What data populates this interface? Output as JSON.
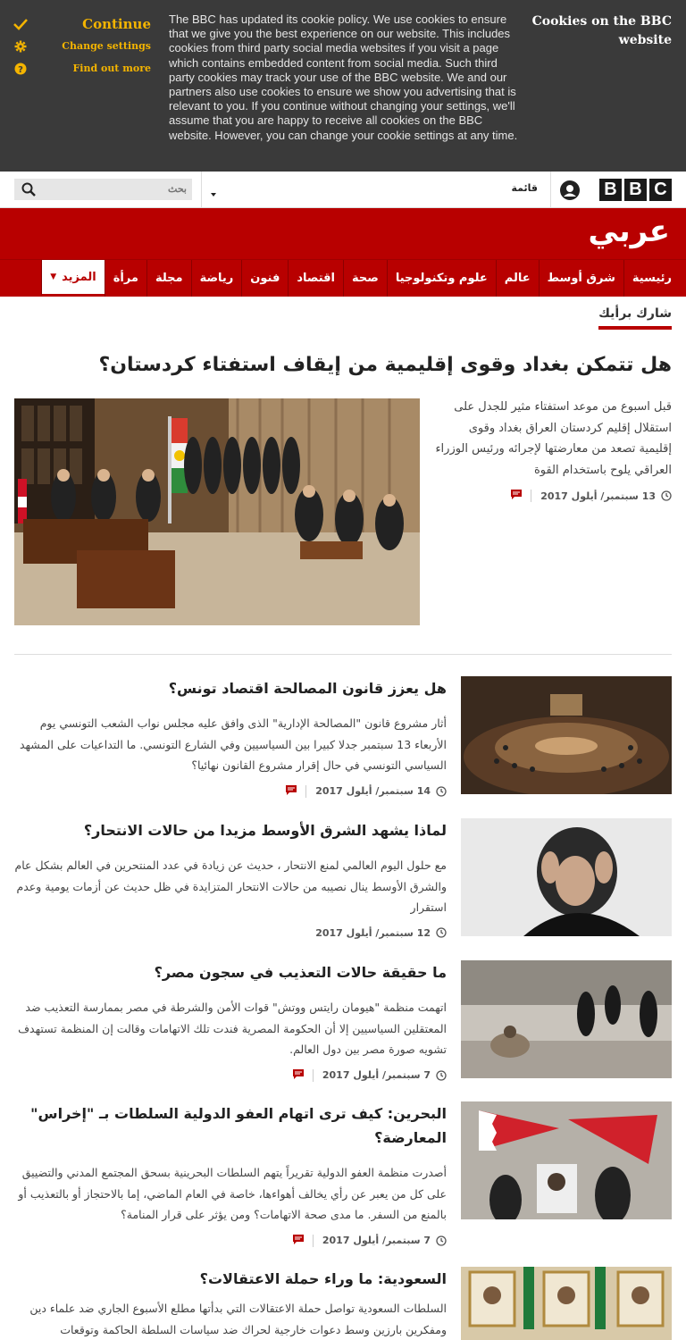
{
  "cookie_banner": {
    "continue_label": "Continue",
    "change_label": "Change settings",
    "find_label": "Find out more",
    "message": "The BBC has updated its cookie policy. We use cookies to ensure that we give you the best experience on our website. This includes cookies from third party social media websites if you visit a page which contains embedded content from social media. Such third party cookies may track your use of the BBC website. We and our partners also use cookies to ensure we show you advertising that is relevant to you. If you continue without changing your settings, we'll assume that you are happy to receive all cookies on the BBC website. However, you can change your cookie settings at any time.",
    "title": "Cookies on the BBC website",
    "accent_color": "#f4b400"
  },
  "masthead": {
    "bbc_letters": [
      "B",
      "B",
      "C"
    ],
    "menu_label": "قائمة",
    "search_placeholder": "بحث"
  },
  "brand": {
    "logo_text": "عربي",
    "color": "#b80000"
  },
  "nav": {
    "items": [
      "رئيسية",
      "شرق أوسط",
      "عالم",
      "علوم وتكنولوجيا",
      "صحة",
      "اقتصاد",
      "فنون",
      "رياضة",
      "مجلة",
      "مرأة"
    ],
    "more_label": "المزيد"
  },
  "section": {
    "title": "شارك برأيك"
  },
  "top_story": {
    "headline": "هل تتمكن بغداد وقوى إقليمية من إيقاف استفتاء كردستان؟",
    "summary": "قبل اسبوع من موعد استفتاء مثير للجدل على استقلال إقليم كردستان العراق بغداد وقوى إقليمية تصعد من معارضتها لإجرائه ورئيس الوزراء العراقي يلوح باستخدام القوة",
    "date": "13 سبتمبر/ أيلول 2017"
  },
  "stories": [
    {
      "headline": "هل يعزز قانون المصالحة اقتصاد تونس؟",
      "summary": "أثار مشروع قانون \"المصالحة الإدارية\" الذى وافق عليه مجلس نواب الشعب التونسي يوم الأربعاء 13 سبتمبر جدلا كبيرا بين السياسيين وفي الشارع التونسي. ما التداعيات على المشهد السياسي التونسي في حال إقرار مشروع القانون نهائيا؟",
      "date": "14 سبتمبر/ أيلول 2017"
    },
    {
      "headline": "لماذا يشهد الشرق الأوسط مزيدا من حالات الانتحار؟",
      "summary": "مع حلول اليوم العالمي لمنع الانتحار ، حديث عن زيادة في عدد المنتحرين في العالم بشكل عام والشرق الأوسط ينال نصيبه من حالات الانتحار المتزايدة في ظل حديث عن أزمات يومية وعدم استقرار",
      "date": "12 سبتمبر/ أيلول 2017"
    },
    {
      "headline": "ما حقيقة حالات التعذيب في سجون مصر؟",
      "summary": "اتهمت منظمة \"هيومان رايتس ووتش\" قوات الأمن والشرطة في مصر بممارسة التعذيب ضد المعتقلين السياسيين إلا أن الحكومة المصرية فندت تلك الاتهامات وقالت إن المنظمة تستهدف تشويه صورة مصر بين دول العالم.",
      "date": "7 سبتمبر/ أيلول 2017"
    },
    {
      "headline": "البحرين: كيف ترى اتهام العفو الدولية السلطات بـ \"إخراس\" المعارضة؟",
      "summary": "أصدرت منظمة العفو الدولية تقريراً يتهم السلطات البحرينية بسحق المجتمع المدني والتضييق على كل من يعبر عن رأي يخالف أهواءها، خاصة في العام الماضي، إما بالاحتجاز أو بالتعذيب أو بالمنع من السفر. ما مدى صحة الاتهامات؟ ومن يؤثر على قرار المنامة؟",
      "date": "7 سبتمبر/ أيلول 2017"
    },
    {
      "headline": "السعودية: ما وراء حملة الاعتقالات؟",
      "summary": "السلطات السعودية تواصل حملة الاعتقالات التي بدأتها مطلع الأسبوع الجاري ضد علماء دين ومفكرين بارزين وسط دعوات خارجية لحراك ضد سياسات السلطة الحاكمة وتوقعات",
      "date": ""
    }
  ]
}
